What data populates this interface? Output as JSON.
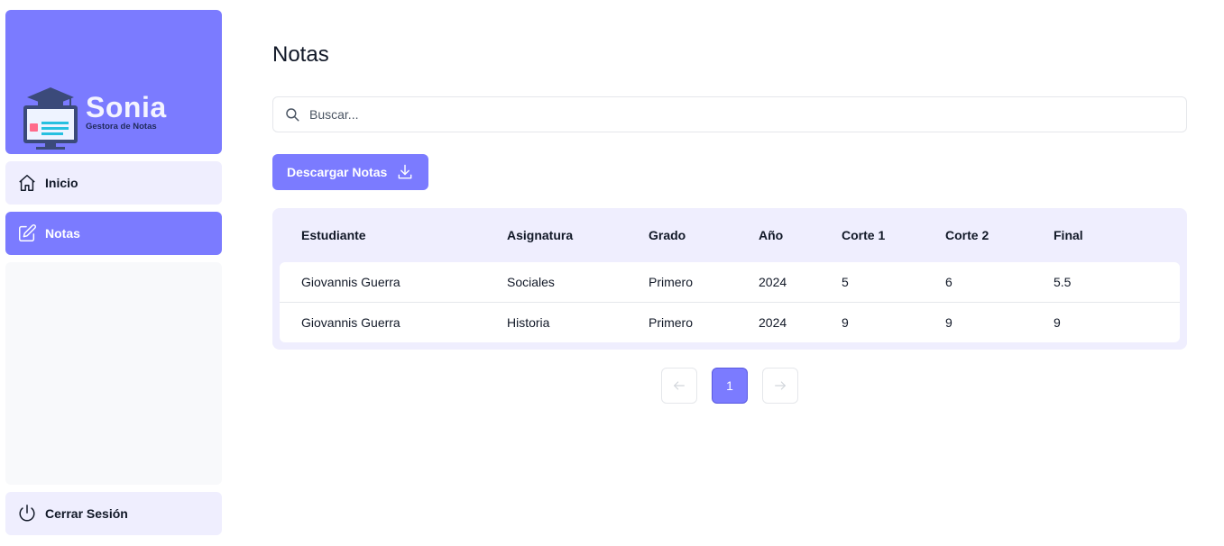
{
  "brand": {
    "name": "Sonia",
    "tagline": "Gestora de Notas",
    "accent_color": "#7b7bff"
  },
  "sidebar": {
    "items": [
      {
        "label": "Inicio",
        "icon": "home-icon",
        "active": false
      },
      {
        "label": "Notas",
        "icon": "edit-icon",
        "active": true
      }
    ],
    "logout": {
      "label": "Cerrar Sesión",
      "icon": "power-icon"
    }
  },
  "main": {
    "title": "Notas",
    "search": {
      "placeholder": "Buscar...",
      "value": ""
    },
    "download_label": "Descargar Notas",
    "table": {
      "columns": [
        "Estudiante",
        "Asignatura",
        "Grado",
        "Año",
        "Corte 1",
        "Corte 2",
        "Final"
      ],
      "rows": [
        [
          "Giovannis Guerra",
          "Sociales",
          "Primero",
          "2024",
          "5",
          "6",
          "5.5"
        ],
        [
          "Giovannis Guerra",
          "Historia",
          "Primero",
          "2024",
          "9",
          "9",
          "9"
        ]
      ]
    },
    "pagination": {
      "current_page": "1"
    }
  }
}
